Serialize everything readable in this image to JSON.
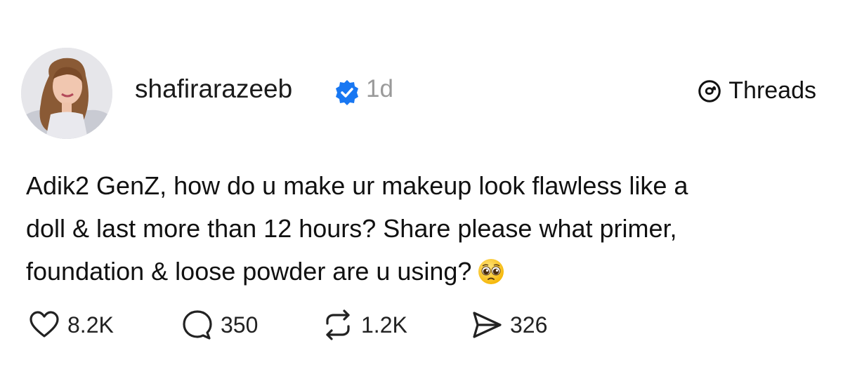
{
  "post": {
    "username": "shafirarazeeb",
    "verified_icon": "verified-badge-icon",
    "time": "1d",
    "brand": {
      "name": "Threads",
      "icon": "threads-logo-icon"
    },
    "text_lines": [
      "Adik2 GenZ, how do u make ur makeup look flawless like a",
      "doll & last more than 12 hours?  Share please what primer,",
      "foundation & loose powder are u using?"
    ],
    "emoji": "pleading-face-emoji",
    "actions": {
      "likes": "8.2K",
      "replies": "350",
      "reposts": "1.2K",
      "shares": "326"
    }
  },
  "colors": {
    "verified": "#1877F2",
    "timestamp": "#9A9A9A",
    "text": "#111111"
  }
}
